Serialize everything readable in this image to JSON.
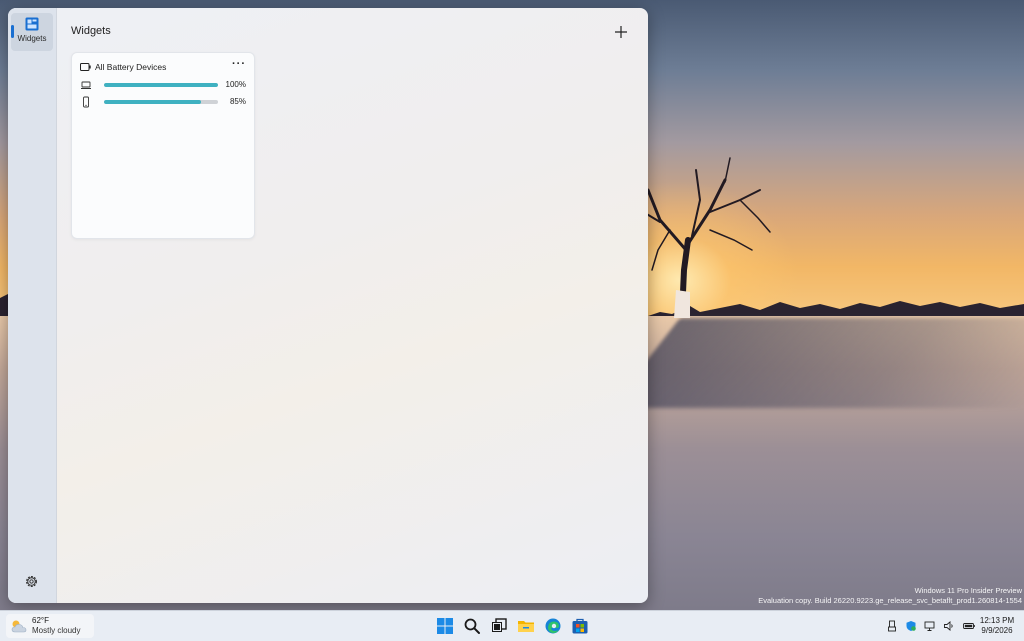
{
  "board": {
    "rail_label": "Widgets",
    "title": "Widgets"
  },
  "battery_widget": {
    "title": "All Battery Devices",
    "menu": "···",
    "devices": [
      {
        "icon": "laptop-icon",
        "level": 1.0,
        "percent_label": "100%"
      },
      {
        "icon": "phone-icon",
        "level": 0.85,
        "percent_label": "85%"
      }
    ],
    "bar_color": "#3fb1c1"
  },
  "watermark": {
    "line1": "Windows 11 Pro Insider Preview",
    "line2": "Evaluation copy. Build 26220.9223.ge_release_svc_betaflt_prod1.260814-1554"
  },
  "taskbar": {
    "weather_temp": "62°F",
    "weather_condition": "Mostly cloudy",
    "apps": [
      "start-icon",
      "search-icon",
      "task-view-icon",
      "file-explorer-icon",
      "edge-icon",
      "store-icon"
    ],
    "tray": [
      "usb-icon",
      "security-icon",
      "network-icon",
      "volume-icon",
      "battery-icon"
    ],
    "time": "12:13 PM",
    "date": "9/9/2026"
  },
  "colors": {
    "accent": "#1a6fd1",
    "battery_bar": "#3fb1c1"
  }
}
